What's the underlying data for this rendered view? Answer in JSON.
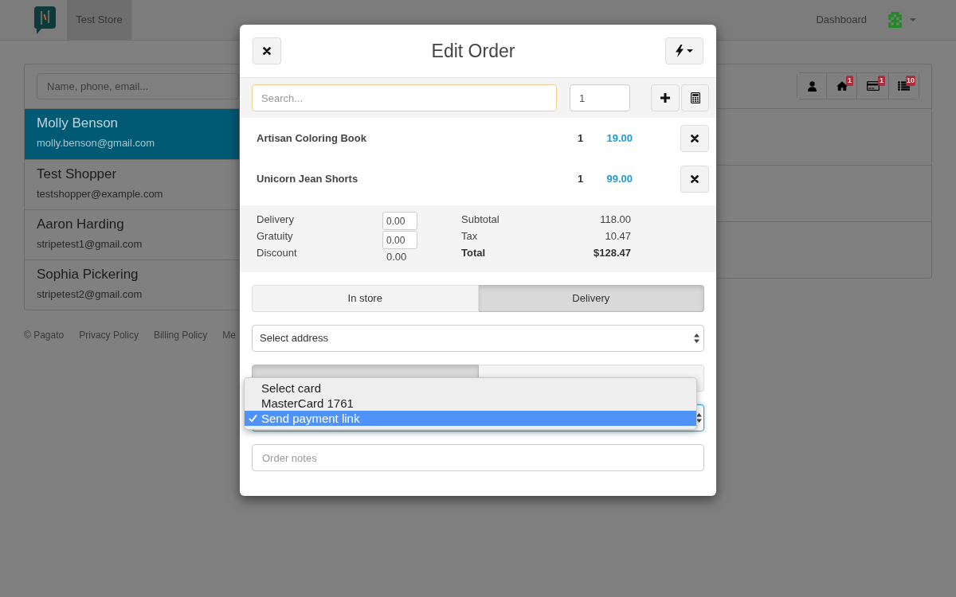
{
  "navbar": {
    "store_tab": {
      "label": "Test Store",
      "selected": true
    },
    "dashboard_link": "Dashboard"
  },
  "customer_search": {
    "placeholder": "Name, phone, email..."
  },
  "customers": [
    {
      "name": "Molly Benson",
      "email": "molly.benson@gmail.com",
      "selected": true
    },
    {
      "name": "Test Shopper",
      "email": "testshopper@example.com",
      "selected": false
    },
    {
      "name": "Aaron Harding",
      "email": "stripetest1@gmail.com",
      "selected": false
    },
    {
      "name": "Sophia Pickering",
      "email": "stripetest2@gmail.com",
      "selected": false
    }
  ],
  "footer": {
    "copyright": "© Pagato",
    "links": [
      "Privacy Policy",
      "Billing Policy",
      "Me"
    ]
  },
  "order_actions": [
    {
      "kind": "user"
    },
    {
      "kind": "home",
      "badge": "1"
    },
    {
      "kind": "card",
      "badge": "1"
    },
    {
      "kind": "list",
      "badge": "10"
    }
  ],
  "modal": {
    "title": "Edit Order",
    "search": {
      "placeholder": "Search..."
    },
    "quantity": "1",
    "items": [
      {
        "name": "Artisan Coloring Book",
        "quantity": "1",
        "price": "19.00"
      },
      {
        "name": "Unicorn Jean Shorts",
        "quantity": "1",
        "price": "99.00"
      }
    ],
    "adjustments": [
      {
        "label": "Delivery",
        "kind": "input",
        "value": "0.00"
      },
      {
        "label": "Gratuity",
        "kind": "input",
        "value": "0.00"
      },
      {
        "label": "Discount",
        "kind": "text",
        "value": "0.00"
      }
    ],
    "totals": [
      {
        "label": "Subtotal",
        "value": "118.00",
        "bold": false
      },
      {
        "label": "Tax",
        "value": "10.47",
        "bold": false
      },
      {
        "label": "Total",
        "value": "$128.47",
        "bold": true
      }
    ],
    "fulfillment_tabs": [
      {
        "label": "In store",
        "selected": false
      },
      {
        "label": "Delivery",
        "selected": true
      }
    ],
    "address_select": {
      "value": "Select address"
    },
    "payment_tabs": [
      {
        "selected": true
      },
      {
        "selected": false
      }
    ],
    "card_select": {
      "options": [
        {
          "label": "Select card",
          "selected": false
        },
        {
          "label": "MasterCard 1761",
          "selected": false
        },
        {
          "label": "Send payment link",
          "selected": true
        }
      ]
    },
    "notes": {
      "placeholder": "Order notes"
    }
  }
}
